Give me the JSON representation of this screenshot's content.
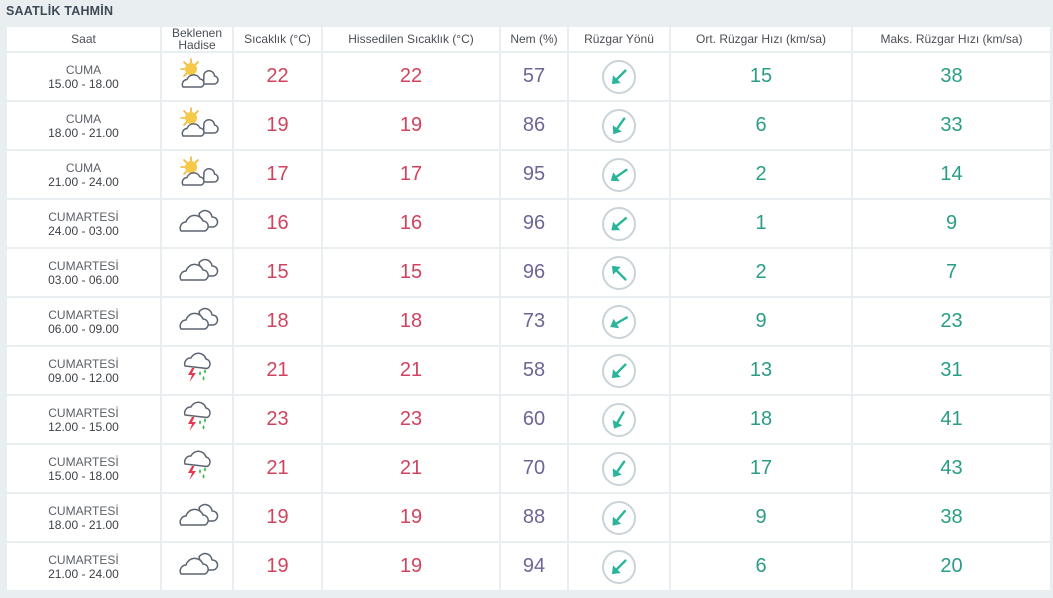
{
  "title": "SAATLİK TAHMİN",
  "headers": {
    "time": "Saat",
    "event_line1": "Beklenen",
    "event_line2": "Hadise",
    "temp": "Sıcaklık (°C)",
    "feels": "Hissedilen Sıcaklık (°C)",
    "humidity": "Nem (%)",
    "wind_dir": "Rüzgar Yönü",
    "avg_wind": "Ort. Rüzgar Hızı (km/sa)",
    "max_wind": "Maks. Rüzgar Hızı (km/sa)"
  },
  "colors": {
    "temperature": "#d1425e",
    "humidity": "#6b6696",
    "wind": "#2a9d86",
    "arrow": "#2ab59a"
  },
  "rows": [
    {
      "day": "CUMA",
      "range": "15.00 - 18.00",
      "icon": "partly-cloudy-icon",
      "temp": "22",
      "feels": "22",
      "hum": "57",
      "dir_deg": 225,
      "avg": "15",
      "max": "38"
    },
    {
      "day": "CUMA",
      "range": "18.00 - 21.00",
      "icon": "partly-cloudy-icon",
      "temp": "19",
      "feels": "19",
      "hum": "86",
      "dir_deg": 215,
      "avg": "6",
      "max": "33"
    },
    {
      "day": "CUMA",
      "range": "21.00 - 24.00",
      "icon": "partly-cloudy-icon",
      "temp": "17",
      "feels": "17",
      "hum": "95",
      "dir_deg": 235,
      "avg": "2",
      "max": "14"
    },
    {
      "day": "CUMARTESİ",
      "range": "24.00 - 03.00",
      "icon": "cloudy-icon",
      "temp": "16",
      "feels": "16",
      "hum": "96",
      "dir_deg": 230,
      "avg": "1",
      "max": "9"
    },
    {
      "day": "CUMARTESİ",
      "range": "03.00 - 06.00",
      "icon": "cloudy-icon",
      "temp": "15",
      "feels": "15",
      "hum": "96",
      "dir_deg": 315,
      "avg": "2",
      "max": "7"
    },
    {
      "day": "CUMARTESİ",
      "range": "06.00 - 09.00",
      "icon": "cloudy-icon",
      "temp": "18",
      "feels": "18",
      "hum": "73",
      "dir_deg": 240,
      "avg": "9",
      "max": "23"
    },
    {
      "day": "CUMARTESİ",
      "range": "09.00 - 12.00",
      "icon": "thunder-rain-icon",
      "temp": "21",
      "feels": "21",
      "hum": "58",
      "dir_deg": 225,
      "avg": "13",
      "max": "31"
    },
    {
      "day": "CUMARTESİ",
      "range": "12.00 - 15.00",
      "icon": "thunder-rain-icon",
      "temp": "23",
      "feels": "23",
      "hum": "60",
      "dir_deg": 210,
      "avg": "18",
      "max": "41"
    },
    {
      "day": "CUMARTESİ",
      "range": "15.00 - 18.00",
      "icon": "thunder-rain-icon",
      "temp": "21",
      "feels": "21",
      "hum": "70",
      "dir_deg": 215,
      "avg": "17",
      "max": "43"
    },
    {
      "day": "CUMARTESİ",
      "range": "18.00 - 21.00",
      "icon": "cloudy-icon",
      "temp": "19",
      "feels": "19",
      "hum": "88",
      "dir_deg": 220,
      "avg": "9",
      "max": "38"
    },
    {
      "day": "CUMARTESİ",
      "range": "21.00 - 24.00",
      "icon": "cloudy-icon",
      "temp": "19",
      "feels": "19",
      "hum": "94",
      "dir_deg": 225,
      "avg": "6",
      "max": "20"
    }
  ]
}
